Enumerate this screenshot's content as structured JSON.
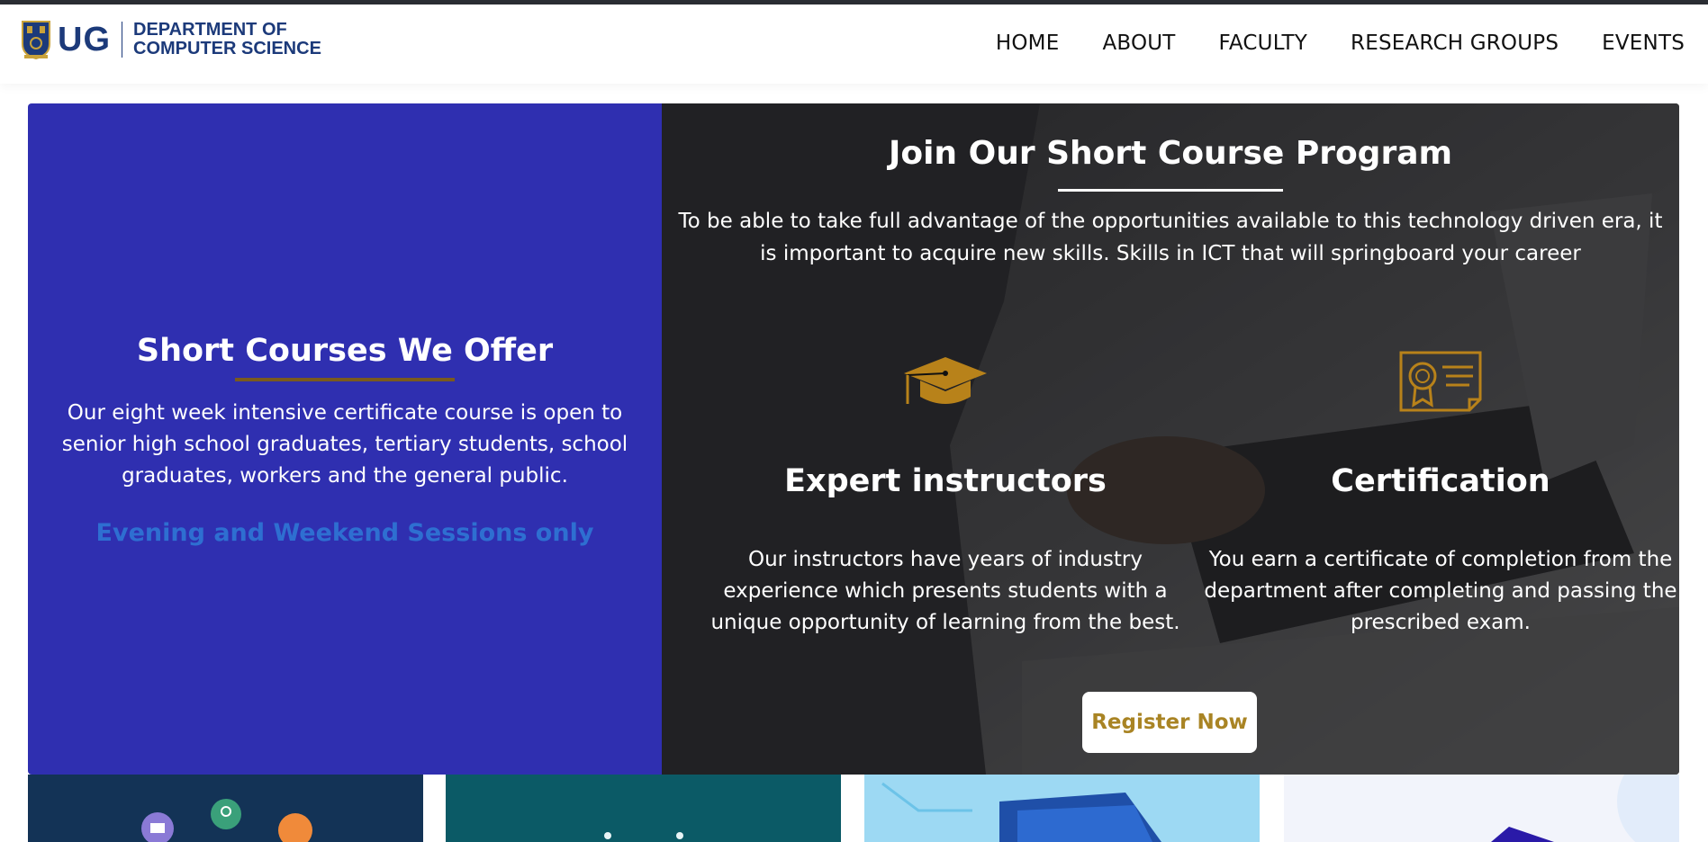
{
  "header": {
    "logo_ug": "UG",
    "logo_dept_line1": "DEPARTMENT OF",
    "logo_dept_line2": "COMPUTER SCIENCE",
    "nav": [
      {
        "label": "HOME"
      },
      {
        "label": "ABOUT"
      },
      {
        "label": "FACULTY"
      },
      {
        "label": "RESEARCH GROUPS"
      },
      {
        "label": "EVENTS"
      }
    ]
  },
  "left_panel": {
    "title": "Short Courses We Offer",
    "text": "Our eight week intensive certificate course is open to senior high school graduates, tertiary students, school graduates, workers and the general public.",
    "accent": "Evening and Weekend Sessions only"
  },
  "right_panel": {
    "title": "Join Our Short Course Program",
    "intro": "To be able to take full advantage of the opportunities available to this technology driven era, it is important to acquire new skills. Skills in ICT that will springboard your career",
    "features": [
      {
        "icon": "graduation-cap-icon",
        "title": "Expert instructors",
        "text": "Our instructors have years of industry experience which presents students with a unique opportunity of learning from the best."
      },
      {
        "icon": "certificate-icon",
        "title": "Certification",
        "text": "You earn a certificate of completion from the department after completing and passing the prescribed exam."
      }
    ],
    "register_label": "Register Now"
  },
  "colors": {
    "brand_blue": "#1c3a7a",
    "left_panel_bg": "#2f2fb0",
    "gold": "#c08a1c",
    "accent_blue": "#2e6fd1"
  }
}
